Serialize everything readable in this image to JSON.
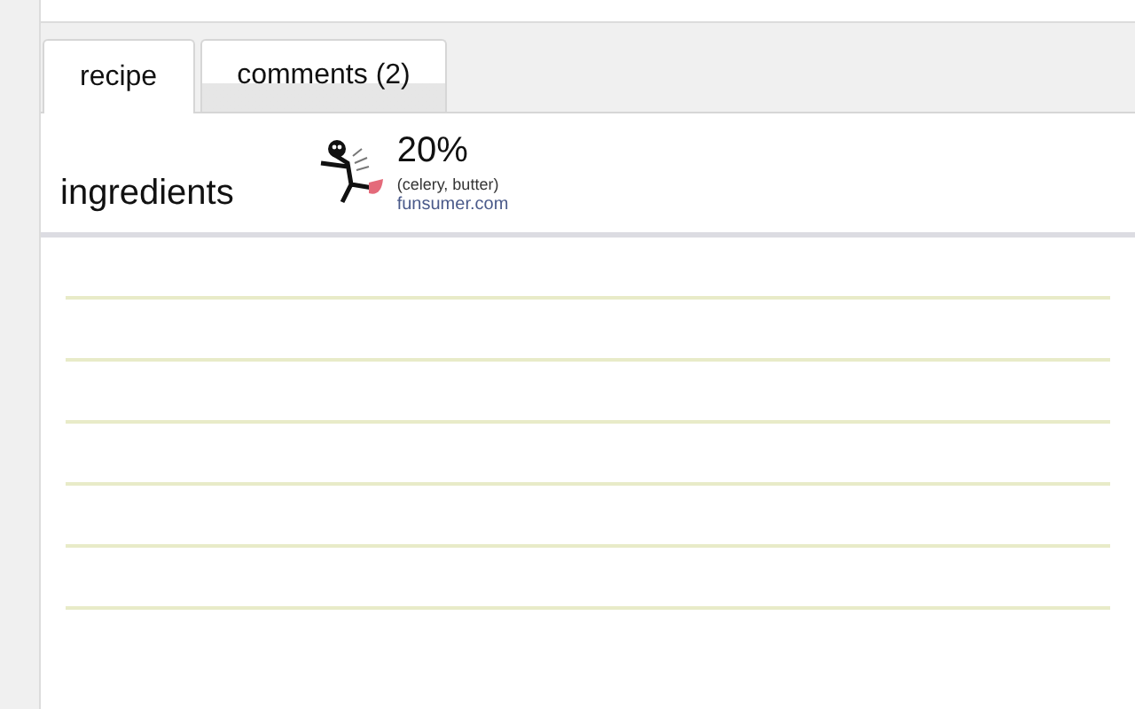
{
  "tabs": [
    {
      "label": "recipe",
      "selected": true
    },
    {
      "label": "comments (2)",
      "selected": false
    }
  ],
  "ingredients": {
    "heading": "ingredients",
    "score": "20%",
    "foods": "(celery, butter)",
    "link": "funsumer.com"
  }
}
